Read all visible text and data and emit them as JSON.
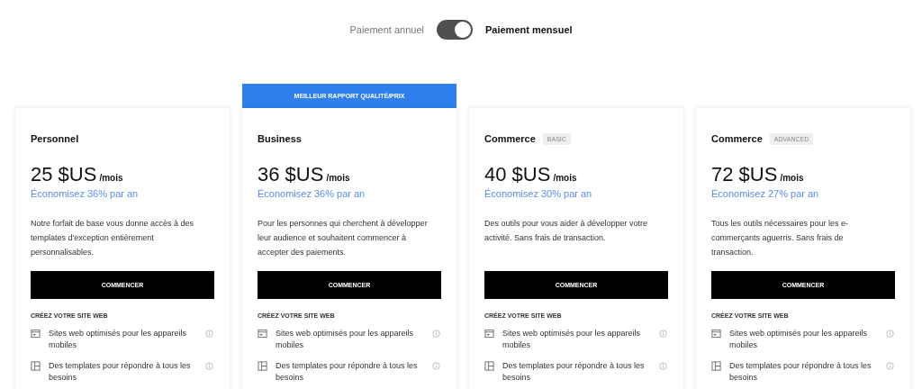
{
  "billing": {
    "annual_label": "Paiement annuel",
    "monthly_label": "Paiement mensuel",
    "monthly": true
  },
  "plans": [
    {
      "name": "Personnel",
      "price": "25 $US",
      "period": "/mois",
      "savings": "Économisez 36% par an",
      "description": "Notre forfait de base vous donne accès à des templates d'exception entièrement personnalisables.",
      "button": "COMMENCER",
      "section": "CRÉEZ VOTRE SITE WEB",
      "features": [
        {
          "kind": "browser",
          "text": "Sites web optimisés pour les appareils mobiles"
        },
        {
          "kind": "layout",
          "text": "Des templates pour répondre à tous les besoins"
        }
      ]
    },
    {
      "name": "Business",
      "banner": "MEILLEUR RAPPORT QUALITÉ/PRIX",
      "price": "36 $US",
      "period": "/mois",
      "savings": "Économisez 36% par an",
      "description": "Pour les personnes qui cherchent à développer leur audience et souhaitent commencer à accepter des paiements.",
      "button": "COMMENCER",
      "section": "CRÉEZ VOTRE SITE WEB",
      "features": [
        {
          "kind": "browser",
          "text": "Sites web optimisés pour les appareils mobiles"
        },
        {
          "kind": "layout",
          "text": "Des templates pour répondre à tous les besoins"
        }
      ]
    },
    {
      "name": "Commerce",
      "tier": "BASIC",
      "price": "40 $US",
      "period": "/mois",
      "savings": "Économisez 30% par an",
      "description": "Des outils pour vous aider à développer votre activité. Sans frais de transaction.",
      "button": "COMMENCER",
      "section": "CRÉEZ VOTRE SITE WEB",
      "features": [
        {
          "kind": "browser",
          "text": "Sites web optimisés pour les appareils mobiles"
        },
        {
          "kind": "layout",
          "text": "Des templates pour répondre à tous les besoins"
        }
      ]
    },
    {
      "name": "Commerce",
      "tier": "ADVANCED",
      "price": "72 $US",
      "period": "/mois",
      "savings": "Économisez 27% par an",
      "description": "Tous les outils nécessaires pour les e-commerçants aguerris. Sans frais de transaction.",
      "button": "COMMENCER",
      "section": "CRÉEZ VOTRE SITE WEB",
      "features": [
        {
          "kind": "browser",
          "text": "Sites web optimisés pour les appareils mobiles"
        },
        {
          "kind": "layout",
          "text": "Des templates pour répondre à tous les besoins"
        }
      ]
    }
  ]
}
